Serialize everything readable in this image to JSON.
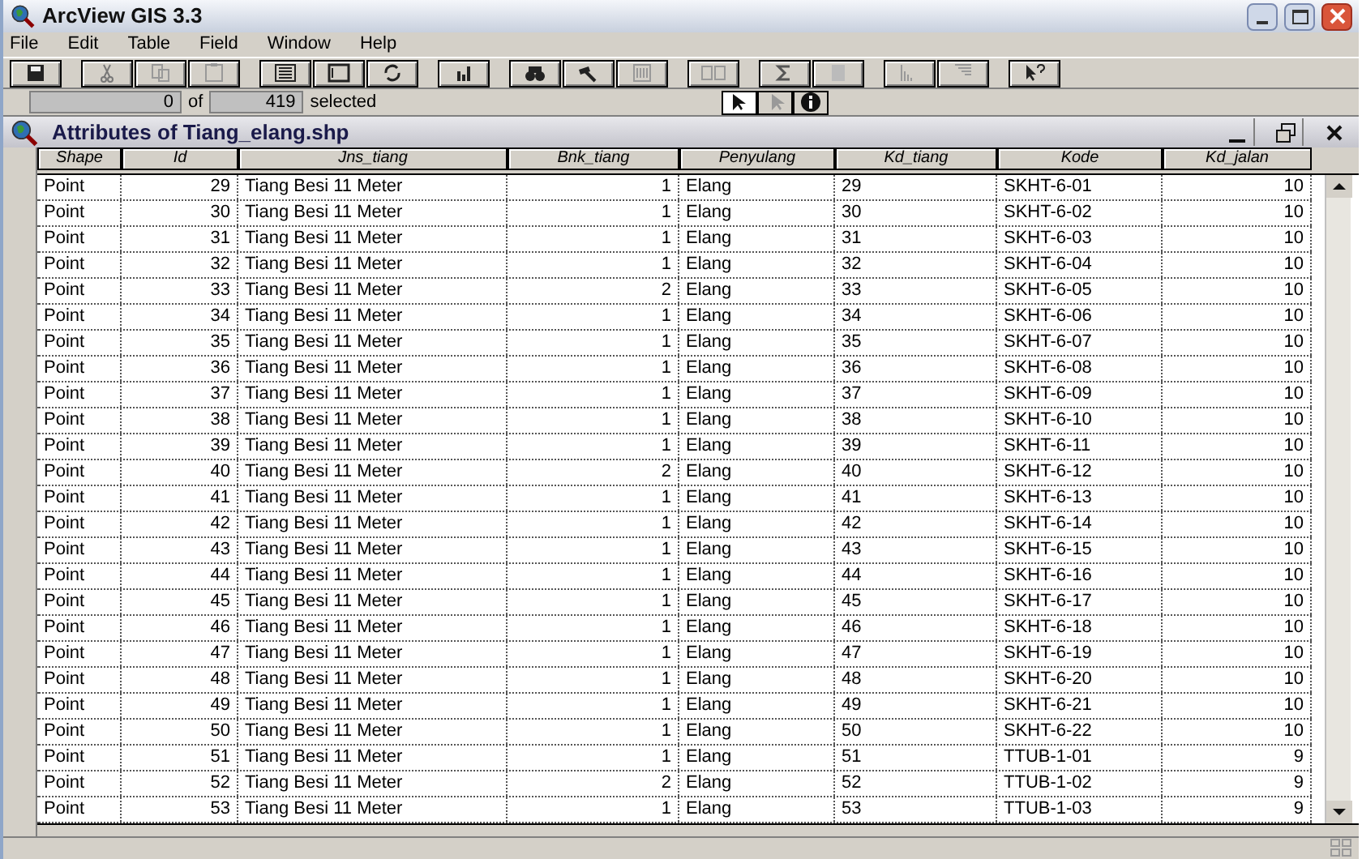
{
  "window": {
    "title": "ArcView GIS 3.3"
  },
  "menu": [
    "File",
    "Edit",
    "Table",
    "Field",
    "Window",
    "Help"
  ],
  "selection": {
    "count": "0",
    "of": "of",
    "total": "419",
    "label": "selected"
  },
  "table_window": {
    "title": "Attributes of Tiang_elang.shp"
  },
  "table": {
    "columns": [
      {
        "label": "Shape"
      },
      {
        "label": "Id"
      },
      {
        "label": "Jns_tiang"
      },
      {
        "label": "Bnk_tiang"
      },
      {
        "label": "Penyulang"
      },
      {
        "label": "Kd_tiang"
      },
      {
        "label": "Kode"
      },
      {
        "label": "Kd_jalan"
      }
    ],
    "rows": [
      [
        "Point",
        "29",
        "Tiang Besi 11 Meter",
        "1",
        "Elang",
        "29",
        "SKHT-6-01",
        "10"
      ],
      [
        "Point",
        "30",
        "Tiang Besi 11 Meter",
        "1",
        "Elang",
        "30",
        "SKHT-6-02",
        "10"
      ],
      [
        "Point",
        "31",
        "Tiang Besi 11 Meter",
        "1",
        "Elang",
        "31",
        "SKHT-6-03",
        "10"
      ],
      [
        "Point",
        "32",
        "Tiang Besi 11 Meter",
        "1",
        "Elang",
        "32",
        "SKHT-6-04",
        "10"
      ],
      [
        "Point",
        "33",
        "Tiang Besi 11 Meter",
        "2",
        "Elang",
        "33",
        "SKHT-6-05",
        "10"
      ],
      [
        "Point",
        "34",
        "Tiang Besi 11 Meter",
        "1",
        "Elang",
        "34",
        "SKHT-6-06",
        "10"
      ],
      [
        "Point",
        "35",
        "Tiang Besi 11 Meter",
        "1",
        "Elang",
        "35",
        "SKHT-6-07",
        "10"
      ],
      [
        "Point",
        "36",
        "Tiang Besi 11 Meter",
        "1",
        "Elang",
        "36",
        "SKHT-6-08",
        "10"
      ],
      [
        "Point",
        "37",
        "Tiang Besi 11 Meter",
        "1",
        "Elang",
        "37",
        "SKHT-6-09",
        "10"
      ],
      [
        "Point",
        "38",
        "Tiang Besi 11 Meter",
        "1",
        "Elang",
        "38",
        "SKHT-6-10",
        "10"
      ],
      [
        "Point",
        "39",
        "Tiang Besi 11 Meter",
        "1",
        "Elang",
        "39",
        "SKHT-6-11",
        "10"
      ],
      [
        "Point",
        "40",
        "Tiang Besi 11 Meter",
        "2",
        "Elang",
        "40",
        "SKHT-6-12",
        "10"
      ],
      [
        "Point",
        "41",
        "Tiang Besi 11 Meter",
        "1",
        "Elang",
        "41",
        "SKHT-6-13",
        "10"
      ],
      [
        "Point",
        "42",
        "Tiang Besi 11 Meter",
        "1",
        "Elang",
        "42",
        "SKHT-6-14",
        "10"
      ],
      [
        "Point",
        "43",
        "Tiang Besi 11 Meter",
        "1",
        "Elang",
        "43",
        "SKHT-6-15",
        "10"
      ],
      [
        "Point",
        "44",
        "Tiang Besi 11 Meter",
        "1",
        "Elang",
        "44",
        "SKHT-6-16",
        "10"
      ],
      [
        "Point",
        "45",
        "Tiang Besi 11 Meter",
        "1",
        "Elang",
        "45",
        "SKHT-6-17",
        "10"
      ],
      [
        "Point",
        "46",
        "Tiang Besi 11 Meter",
        "1",
        "Elang",
        "46",
        "SKHT-6-18",
        "10"
      ],
      [
        "Point",
        "47",
        "Tiang Besi 11 Meter",
        "1",
        "Elang",
        "47",
        "SKHT-6-19",
        "10"
      ],
      [
        "Point",
        "48",
        "Tiang Besi 11 Meter",
        "1",
        "Elang",
        "48",
        "SKHT-6-20",
        "10"
      ],
      [
        "Point",
        "49",
        "Tiang Besi 11 Meter",
        "1",
        "Elang",
        "49",
        "SKHT-6-21",
        "10"
      ],
      [
        "Point",
        "50",
        "Tiang Besi 11 Meter",
        "1",
        "Elang",
        "50",
        "SKHT-6-22",
        "10"
      ],
      [
        "Point",
        "51",
        "Tiang Besi 11 Meter",
        "1",
        "Elang",
        "51",
        "TTUB-1-01",
        "9"
      ],
      [
        "Point",
        "52",
        "Tiang Besi 11 Meter",
        "2",
        "Elang",
        "52",
        "TTUB-1-02",
        "9"
      ],
      [
        "Point",
        "53",
        "Tiang Besi 11 Meter",
        "1",
        "Elang",
        "53",
        "TTUB-1-03",
        "9"
      ]
    ]
  }
}
